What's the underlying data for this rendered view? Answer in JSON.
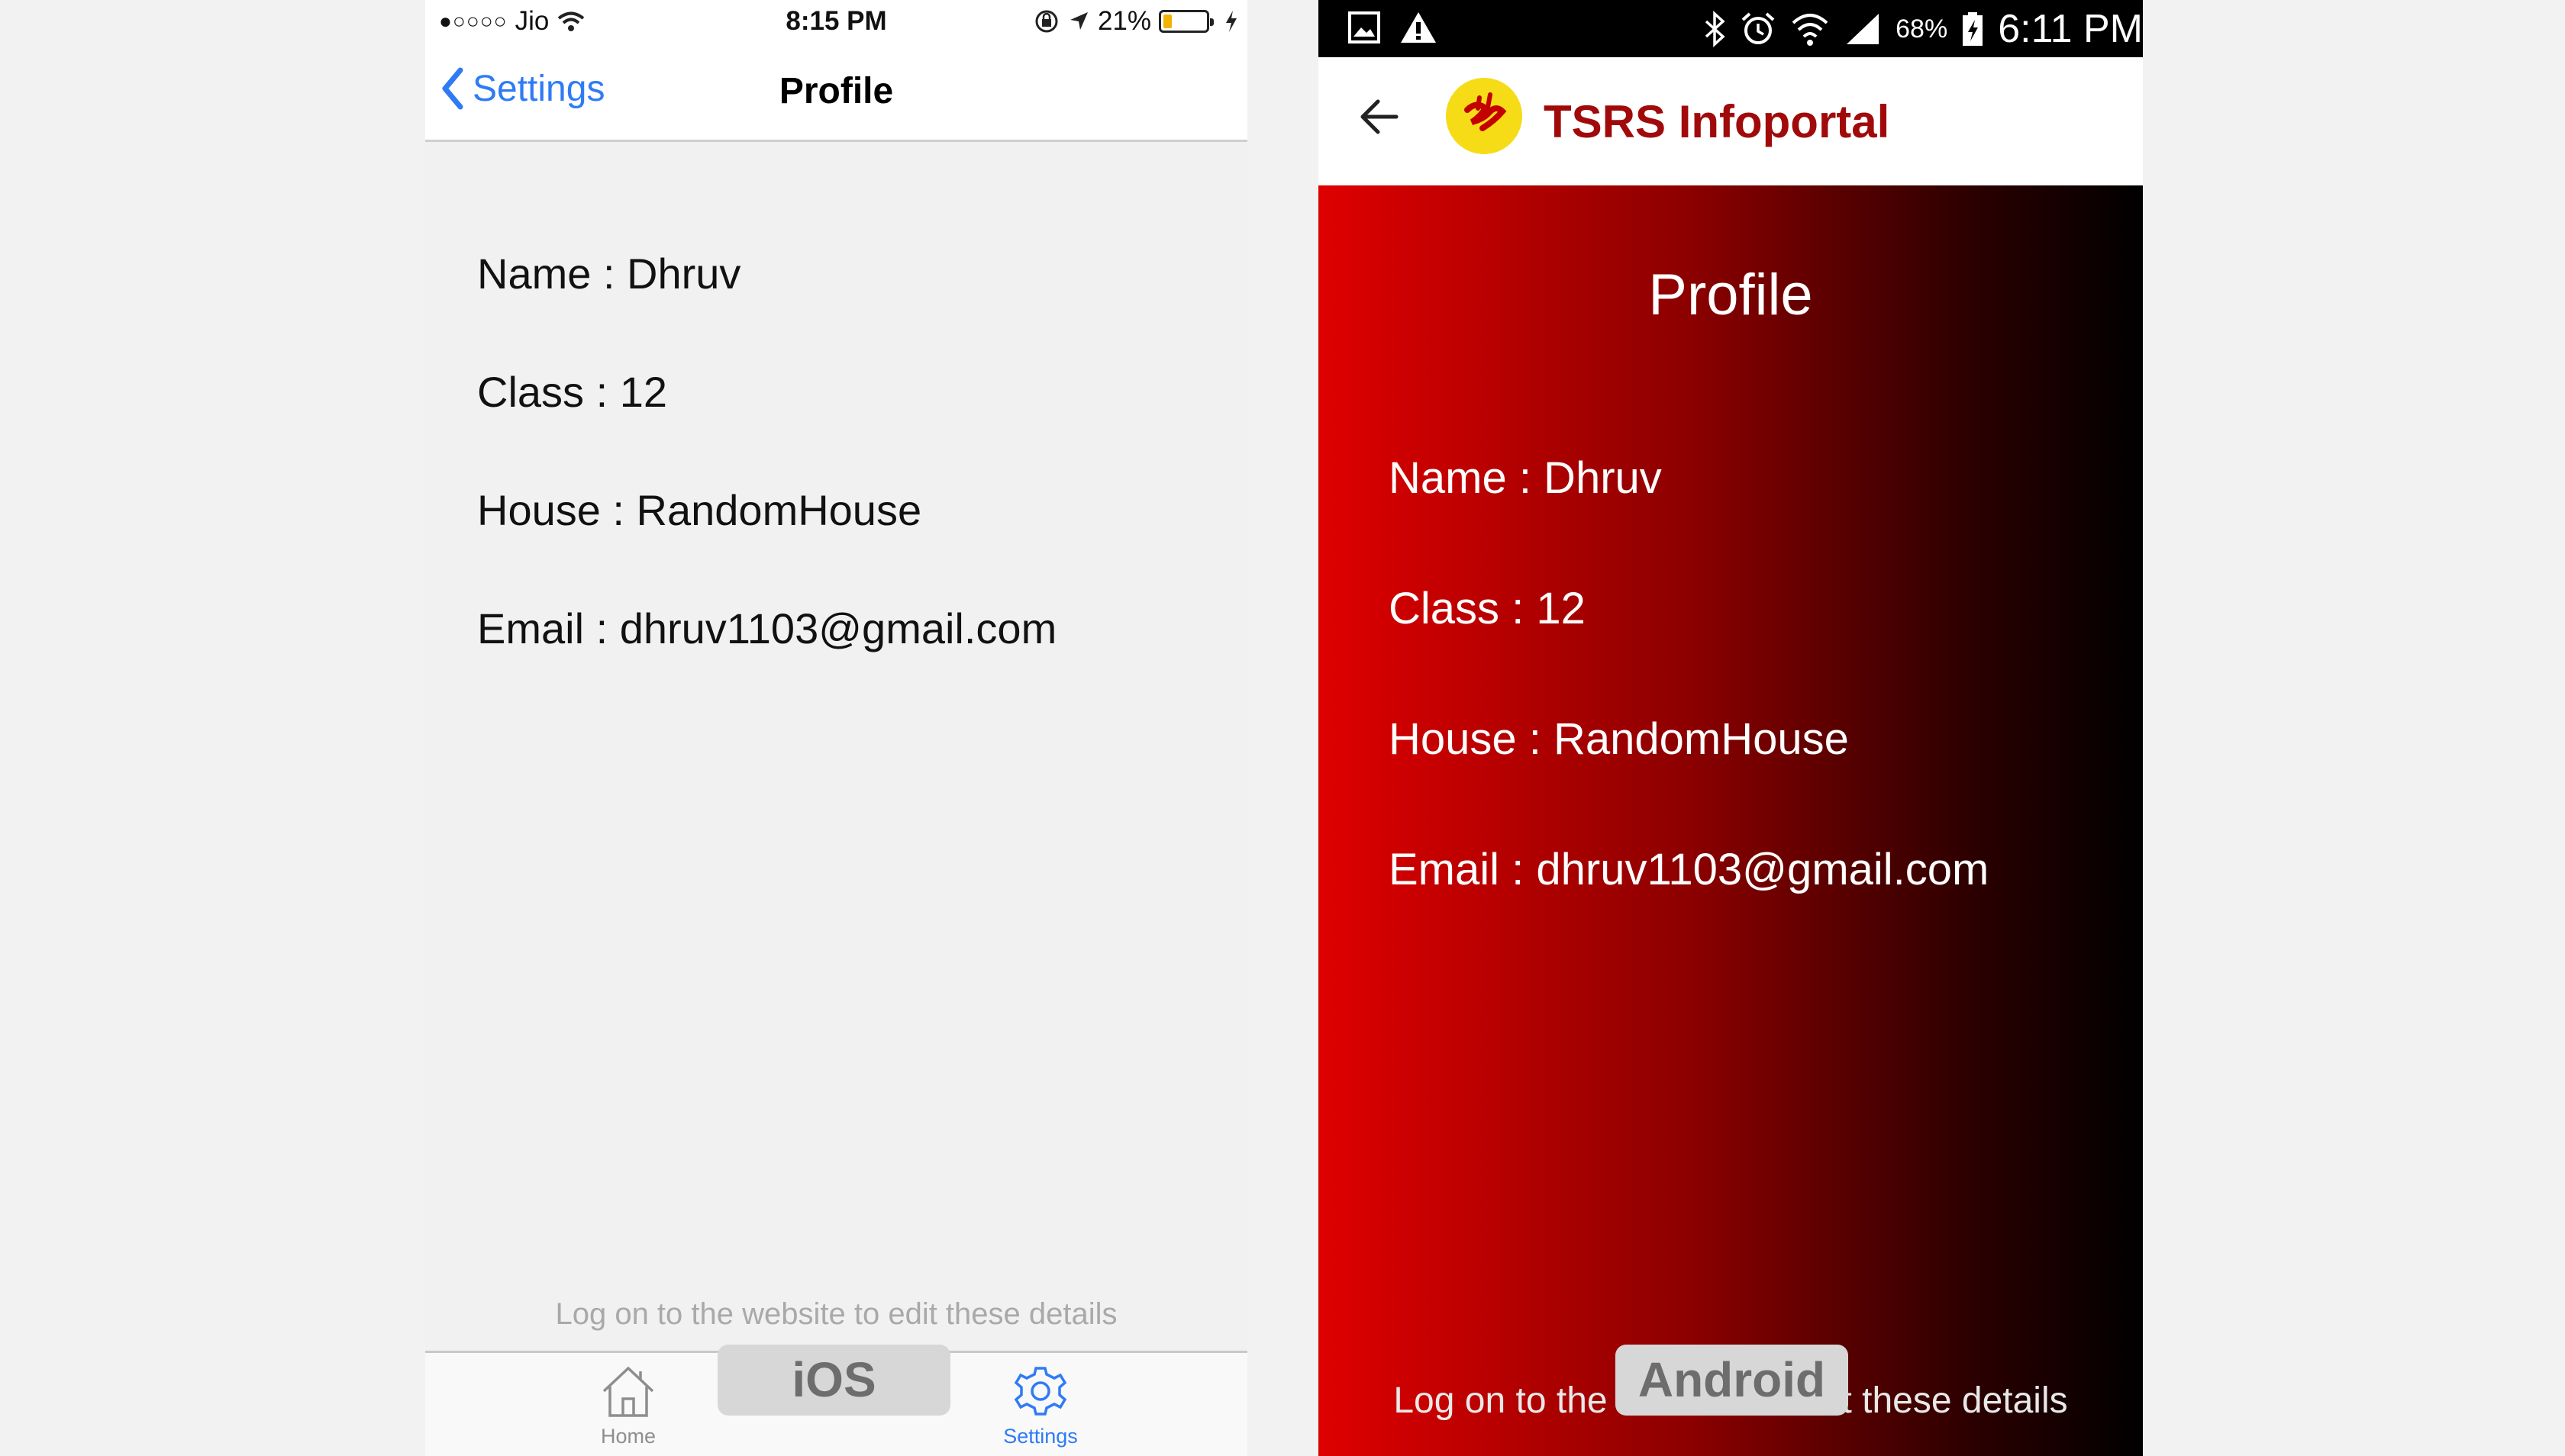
{
  "ios": {
    "status": {
      "carrier": "Jio",
      "time": "8:15 PM",
      "battery": "21%"
    },
    "nav": {
      "back_label": "Settings",
      "title": "Profile"
    },
    "fields": [
      {
        "text": "Name : Dhruv"
      },
      {
        "text": "Class : 12"
      },
      {
        "text": "House : RandomHouse"
      },
      {
        "text": "Email : dhruv1103@gmail.com"
      }
    ],
    "note": "Log on to the website to edit these details",
    "tabs": {
      "home": "Home",
      "settings": "Settings"
    },
    "badge": "iOS",
    "colors": {
      "accent": "#2f7bf6",
      "battery_fill": "#f0b400"
    }
  },
  "android": {
    "status": {
      "battery": "68%",
      "time": "6:11 PM"
    },
    "appbar": {
      "title": "TSRS Infoportal"
    },
    "heading": "Profile",
    "fields": [
      {
        "text": "Name : Dhruv"
      },
      {
        "text": "Class : 12"
      },
      {
        "text": "House : RandomHouse"
      },
      {
        "text": "Email : dhruv1103@gmail.com"
      }
    ],
    "note": "Log on to the website to edit these details",
    "badge": "Android",
    "colors": {
      "title": "#a10a0a",
      "gradient_start": "#df0000",
      "gradient_end": "#000000",
      "logo_bg": "#f6dc17"
    }
  }
}
